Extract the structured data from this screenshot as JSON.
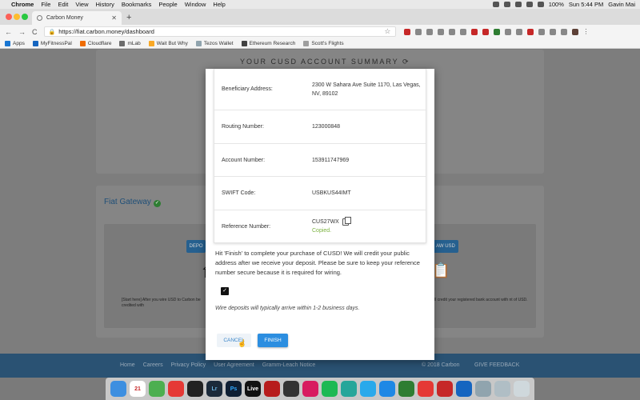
{
  "menubar": {
    "app": "Chrome",
    "items": [
      "File",
      "Edit",
      "View",
      "History",
      "Bookmarks",
      "People",
      "Window",
      "Help"
    ],
    "battery": "100%",
    "clock": "Sun 5:44 PM",
    "user": "Gavin Mai"
  },
  "browser": {
    "tab_title": "Carbon Money",
    "url": "https://fiat.carbon.money/dashboard",
    "bookmarks": [
      "Apps",
      "MyFitnessPal",
      "Cloudflare",
      "mLab",
      "Wait But Why",
      "Tezos Wallet",
      "Ethereum Research",
      "Scott's Flights"
    ]
  },
  "page": {
    "summary_title": "YOUR CUSD ACCOUNT SUMMARY",
    "fiat_title": "Fiat Gateway",
    "deposit_btn": "DEPO",
    "withdraw_btn": "AW USD",
    "left_text": "[Start here] After you wire USD to Carbon be credited with",
    "right_text": "ill credit your registered bank account with nt of USD.",
    "footer_links": [
      "Home",
      "Careers",
      "Privacy Policy",
      "User Agreement",
      "Gramm-Leach Notice"
    ],
    "footer_copy": "© 2018 Carbon",
    "footer_feedback": "GIVE FEEDBACK"
  },
  "modal": {
    "rows": [
      {
        "label": "Beneficiary Address:",
        "value": "2300 W Sahara Ave Suite 1170, Las Vegas, NV, 89102"
      },
      {
        "label": "Routing Number:",
        "value": "123000848"
      },
      {
        "label": "Account Number:",
        "value": "153911747969"
      },
      {
        "label": "SWIFT Code:",
        "value": "USBKUS44IMT"
      },
      {
        "label": "Reference Number:",
        "value": "CUS27WX"
      }
    ],
    "copied_label": "Copied.",
    "instructions": "Hit 'Finish' to complete your purchase of CUSD! We will credit your public address after we receive your deposit. Please be sure to keep your reference number secure because it is required for wiring.",
    "checkbox_checked": true,
    "note": "Wire deposits will typically arrive within 1-2 business days.",
    "cancel_label": "CANCEL",
    "finish_label": "FINISH"
  },
  "dock": {
    "calendar_day": "21",
    "lr_label": "Lr",
    "ps_label": "Ps",
    "live_label": "Live"
  },
  "colors": {
    "primary": "#2c8ee0",
    "copied": "#7cb342",
    "footer": "#2a5273"
  }
}
